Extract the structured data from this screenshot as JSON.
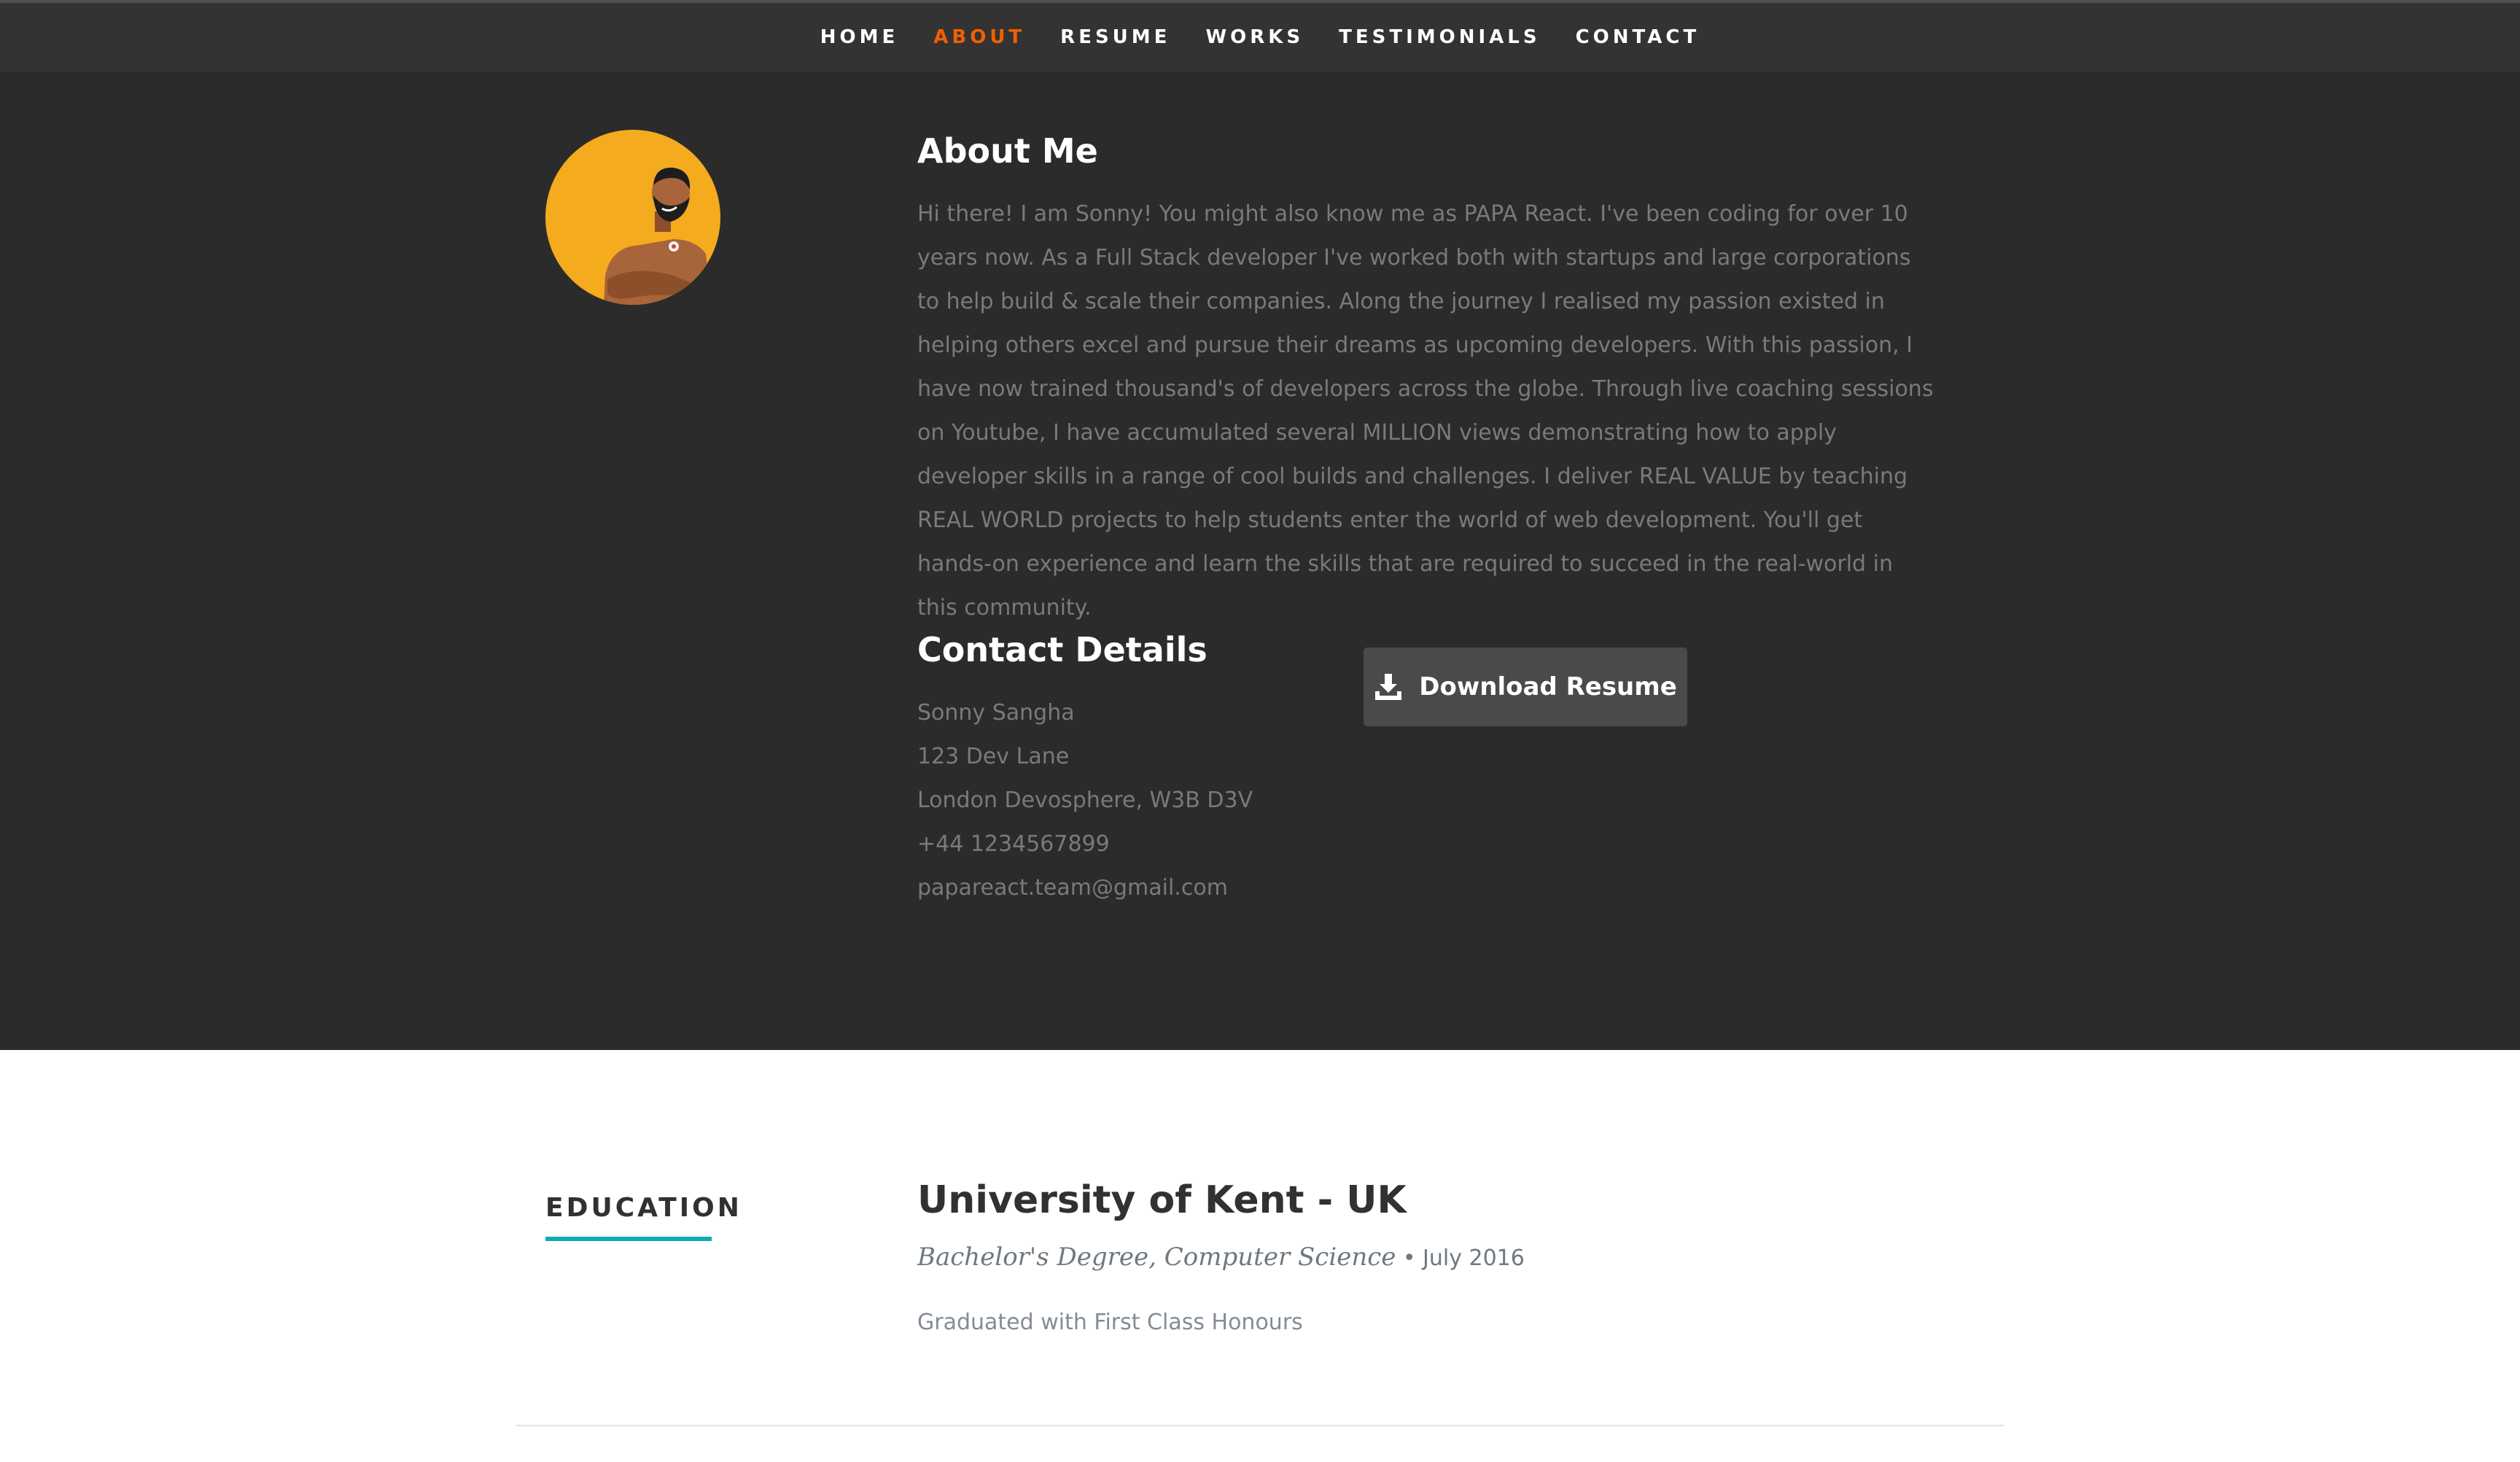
{
  "nav": {
    "items": [
      {
        "label": "HOME",
        "active": false
      },
      {
        "label": "ABOUT",
        "active": true
      },
      {
        "label": "RESUME",
        "active": false
      },
      {
        "label": "WORKS",
        "active": false
      },
      {
        "label": "TESTIMONIALS",
        "active": false
      },
      {
        "label": "CONTACT",
        "active": false
      }
    ],
    "active_color": "#F06000"
  },
  "about": {
    "title": "About Me",
    "text": "Hi there! I am Sonny! You might also know me as PAPA React. I've been coding for over 10 years now. As a Full Stack developer I've worked both with startups and large corporations to help build & scale their companies. Along the journey I realised my passion existed in helping others excel and pursue their dreams as upcoming developers. With this passion, I have now trained thousand's of developers across the globe. Through live coaching sessions on Youtube, I have accumulated several MILLION views demonstrating how to apply developer skills in a range of cool builds and challenges. I deliver REAL VALUE by teaching REAL WORLD projects to help students enter the world of web development. You'll get hands-on experience and learn the skills that are required to succeed in the real-world in this community.",
    "avatar_bg": "#f5ab1e"
  },
  "contact": {
    "title": "Contact Details",
    "name": "Sonny Sangha",
    "street": "123 Dev Lane",
    "city": "London Devosphere, W3B D3V",
    "phone": "+44 1234567899",
    "email": "papareact.team@gmail.com"
  },
  "download": {
    "label": "Download Resume",
    "icon": "download-icon"
  },
  "education": {
    "section_label": "EDUCATION",
    "accent": "#11abb0",
    "school": "University of Kent - UK",
    "degree": "Bachelor's Degree, Computer Science",
    "bullet": "•",
    "date": "July 2016",
    "description": "Graduated with First Class Honours"
  }
}
